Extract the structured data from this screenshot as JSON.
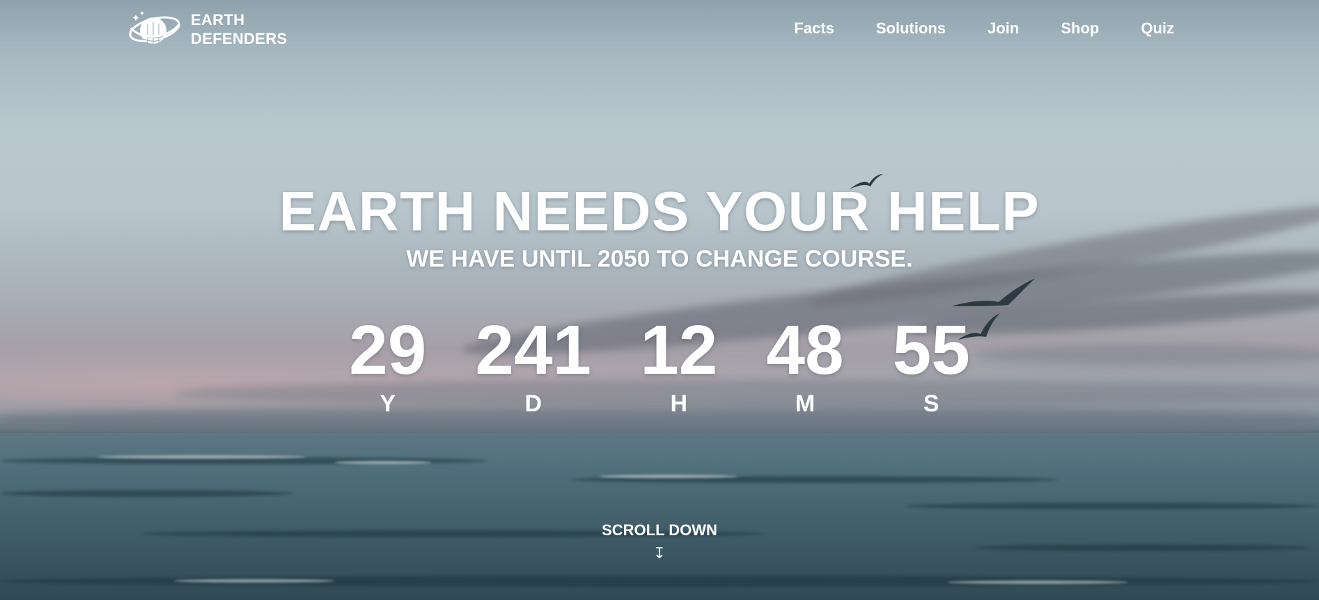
{
  "brand": {
    "name_line1": "EARTH",
    "name_line2": "DEFENDERS",
    "logo_icon": "globe-with-ring-icon"
  },
  "nav": {
    "items": [
      {
        "label": "Facts"
      },
      {
        "label": "Solutions"
      },
      {
        "label": "Join"
      },
      {
        "label": "Shop"
      },
      {
        "label": "Quiz"
      }
    ]
  },
  "hero": {
    "title": "EARTH NEEDS YOUR HELP",
    "subtitle": "WE HAVE UNTIL 2050 TO CHANGE COURSE."
  },
  "countdown": {
    "years": {
      "value": "29",
      "label": "Y"
    },
    "days": {
      "value": "241",
      "label": "D"
    },
    "hours": {
      "value": "12",
      "label": "H"
    },
    "minutes": {
      "value": "48",
      "label": "M"
    },
    "seconds": {
      "value": "55",
      "label": "S"
    }
  },
  "scroll": {
    "label": "SCROLL DOWN",
    "icon": "arrow-down-icon",
    "arrow": "↧"
  },
  "colors": {
    "text": "#ffffff",
    "sky": "#bac8cf",
    "sea": "#46636f"
  }
}
